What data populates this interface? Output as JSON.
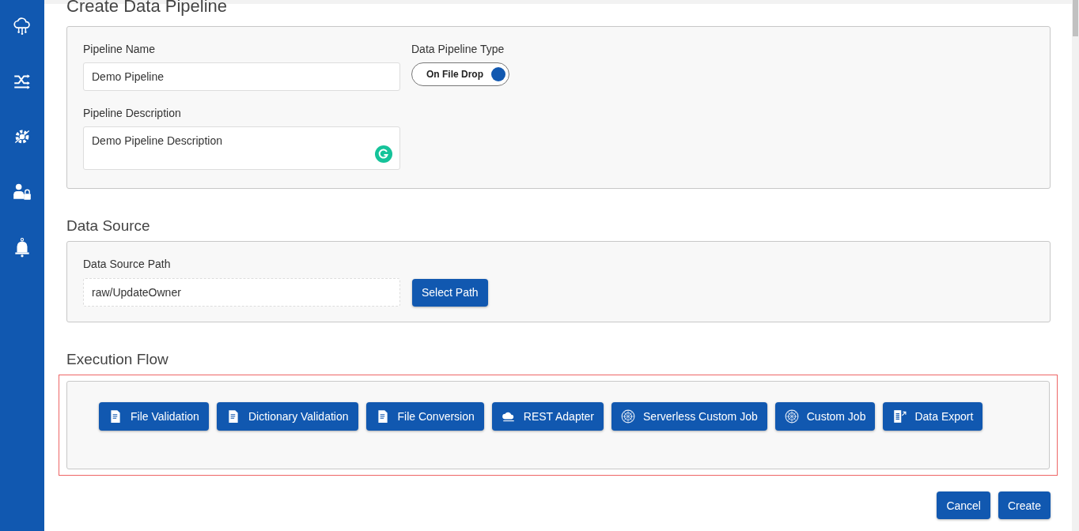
{
  "title": "Create Data Pipeline",
  "sidebar": {
    "items": [
      {
        "kind": "cloud"
      },
      {
        "kind": "flow"
      },
      {
        "kind": "gear"
      },
      {
        "kind": "user"
      },
      {
        "kind": "bell"
      }
    ]
  },
  "pipeline": {
    "name_label": "Pipeline Name",
    "name_value": "Demo Pipeline",
    "type_label": "Data Pipeline Type",
    "type_toggle": {
      "label": "On File Drop",
      "on": true
    },
    "description_label": "Pipeline Description",
    "description_value": "Demo Pipeline Description"
  },
  "data_source": {
    "heading": "Data Source",
    "path_label": "Data Source Path",
    "path_value": "raw/UpdateOwner",
    "select_button": "Select Path"
  },
  "execution_flow": {
    "heading": "Execution Flow",
    "steps": [
      {
        "label": "File Validation",
        "kind": "file"
      },
      {
        "label": "Dictionary Validation",
        "kind": "file"
      },
      {
        "label": "File Conversion",
        "kind": "file"
      },
      {
        "label": "REST Adapter",
        "kind": "cloud"
      },
      {
        "label": "Serverless Custom Job",
        "kind": "globe"
      },
      {
        "label": "Custom Job",
        "kind": "globe"
      },
      {
        "label": "Data Export",
        "kind": "doc"
      }
    ]
  },
  "buttons": [
    "Cancel",
    "Create"
  ]
}
